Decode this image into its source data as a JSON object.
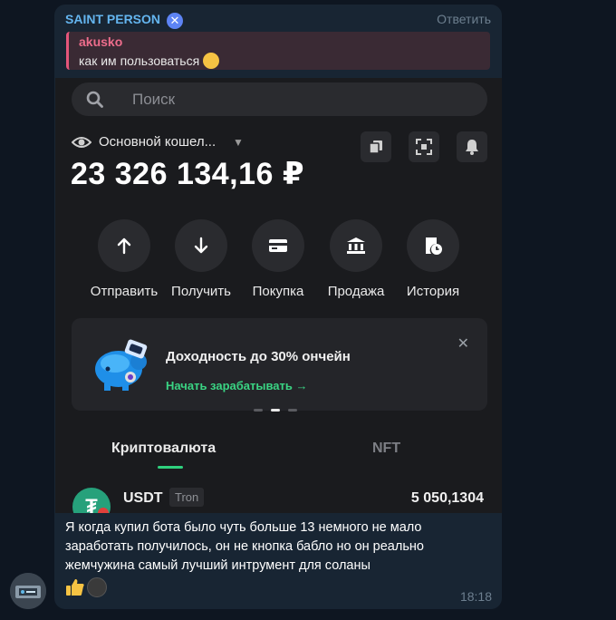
{
  "message": {
    "sender": "SAINT PERSON",
    "sender_badge": "✕",
    "reply_label": "Ответить",
    "quote_author": "akusko",
    "quote_text": "как им пользоваться",
    "body": "Я когда купил бота было чуть больше 13 немного не мало заработать получилось, он не кнопка бабло но он реально жемчужина самый лучший интрумент для соланы",
    "time": "18:18",
    "reactions": [
      "thumbs-up-icon",
      "user-avatar"
    ]
  },
  "wallet_screenshot": {
    "search_placeholder": "Поиск",
    "wallet_name": "Основной кошел...",
    "balance": "23 326 134,16 ₽",
    "actions": [
      {
        "label": "Отправить",
        "icon": "arrow-up-icon"
      },
      {
        "label": "Получить",
        "icon": "arrow-down-icon"
      },
      {
        "label": "Покупка",
        "icon": "card-icon"
      },
      {
        "label": "Продажа",
        "icon": "bank-icon"
      },
      {
        "label": "История",
        "icon": "history-icon"
      }
    ],
    "promo": {
      "title": "Доходность до 30% ончейн",
      "link": "Начать зарабатывать",
      "arrow": "→",
      "close": "✕"
    },
    "tabs": [
      "Криптовалюта",
      "NFT"
    ],
    "asset": {
      "symbol_glyph": "₮",
      "name": "USDT",
      "chain": "Tron",
      "amount": "5 050,1304"
    }
  },
  "colors": {
    "background": "#0e1621",
    "bubble": "#182533",
    "accent_green": "#2fd17e",
    "sender": "#64b5ef",
    "quote_accent": "#e4557a"
  }
}
